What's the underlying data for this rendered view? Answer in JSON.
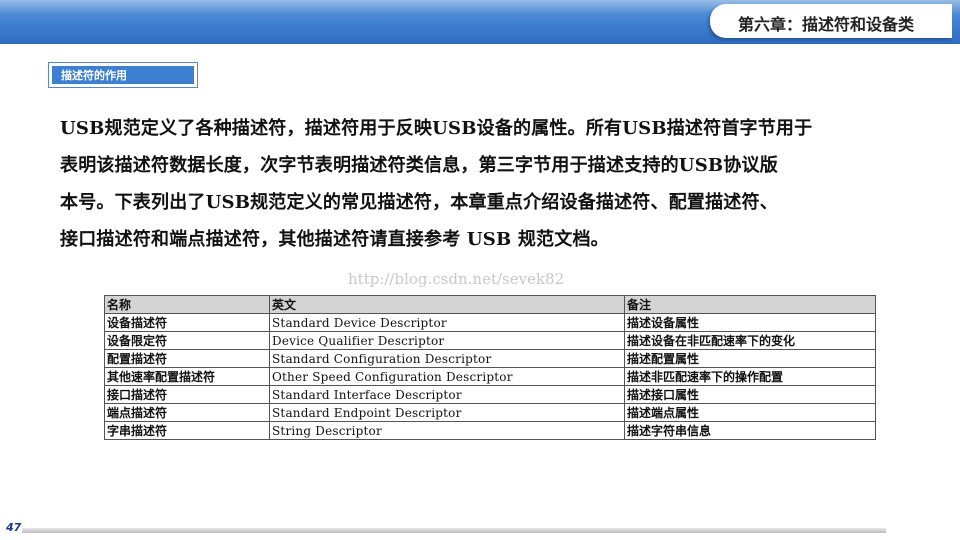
{
  "header": {
    "chapter_title": "第六章：描述符和设备类"
  },
  "section": {
    "label": "描述符的作用"
  },
  "paragraph": {
    "lines": [
      "USB规范定义了各种描述符，描述符用于反映USB设备的属性。所有USB描述符首字节用于",
      "表明该描述符数据长度，次字节表明描述符类信息，第三字节用于描述支持的USB协议版",
      "本号。下表列出了USB规范定义的常见描述符，本章重点介绍设备描述符、配置描述符、",
      "接口描述符和端点描述符，其他描述符请直接参考  USB  规范文档。"
    ]
  },
  "watermark": "http://blog.csdn.net/sevek82",
  "table": {
    "headers": [
      "名称",
      "英文",
      "备注"
    ],
    "rows": [
      [
        "设备描述符",
        "Standard Device Descriptor",
        "描述设备属性"
      ],
      [
        "设备限定符",
        "Device Qualifier Descriptor",
        "描述设备在非匹配速率下的变化"
      ],
      [
        "配置描述符",
        "Standard Configuration Descriptor",
        "描述配置属性"
      ],
      [
        "其他速率配置描述符",
        "Other Speed Configuration Descriptor",
        "描述非匹配速率下的操作配置"
      ],
      [
        "接口描述符",
        "Standard Interface Descriptor",
        "描述接口属性"
      ],
      [
        "端点描述符",
        "Standard Endpoint Descriptor",
        "描述端点属性"
      ],
      [
        "字串描述符",
        "String Descriptor",
        "描述字符串信息"
      ]
    ]
  },
  "footer": {
    "page_number": "47"
  }
}
